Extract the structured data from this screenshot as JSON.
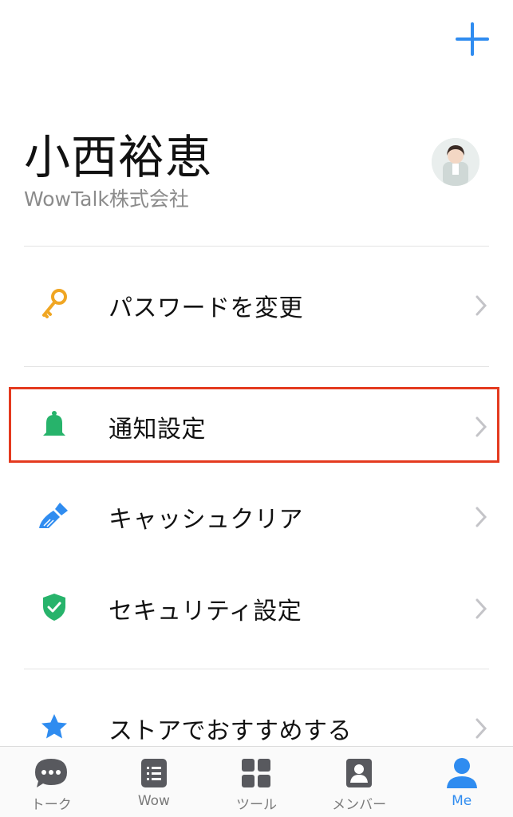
{
  "header": {
    "add_icon": "plus-icon",
    "accent": "#2f8cf0"
  },
  "profile": {
    "name": "小西裕恵",
    "company": "WowTalk株式会社"
  },
  "menu": {
    "password": {
      "label": "パスワードを変更",
      "icon": "key-icon"
    },
    "notifications": {
      "label": "通知設定",
      "icon": "bell-icon"
    },
    "cache": {
      "label": "キャッシュクリア",
      "icon": "brush-icon"
    },
    "security": {
      "label": "セキュリティ設定",
      "icon": "shield-icon"
    },
    "store": {
      "label": "ストアでおすすめする",
      "icon": "star-icon"
    }
  },
  "tabs": [
    {
      "label": "トーク",
      "icon": "chat-bubble-icon"
    },
    {
      "label": "Wow",
      "icon": "note-icon"
    },
    {
      "label": "ツール",
      "icon": "grid-icon"
    },
    {
      "label": "メンバー",
      "icon": "contact-card-icon"
    },
    {
      "label": "Me",
      "icon": "person-icon",
      "active": true
    }
  ],
  "colors": {
    "highlight": "#e43a1f",
    "key": "#f0a623",
    "bell": "#27b36b",
    "brush": "#2f8cf0",
    "shield": "#27b36b",
    "star": "#2f8cf0"
  }
}
